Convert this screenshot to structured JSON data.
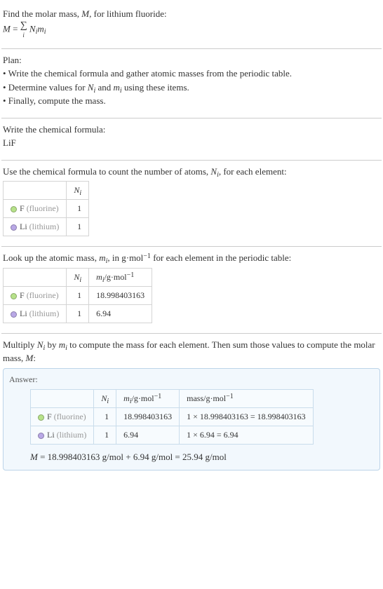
{
  "step1": {
    "intro": "Find the molar mass, ",
    "var_M": "M",
    "intro2": ", for lithium fluoride:",
    "formula_prefix": "M",
    "formula_eq": " = ",
    "sigma": "∑",
    "sigma_sub": "i",
    "Ni": "N",
    "Ni_sub": "i",
    "mi": "m",
    "mi_sub": "i"
  },
  "plan": {
    "head": "Plan:",
    "l1_a": "• Write the chemical formula and gather atomic masses from the periodic table.",
    "l2_pre": "• Determine values for ",
    "l2_mid": " and ",
    "l2_post": " using these items.",
    "l3": "• Finally, compute the mass."
  },
  "chem": {
    "head": "Write the chemical formula:",
    "formula": "LiF"
  },
  "count": {
    "head_a": "Use the chemical formula to count the number of atoms, ",
    "head_b": ", for each element:",
    "col_n": "N",
    "col_n_sub": "i",
    "rows": [
      {
        "color": "#b7e28a",
        "name": "F",
        "paren": " (fluorine)",
        "n": "1"
      },
      {
        "color": "#b9a8e6",
        "name": "Li",
        "paren": " (lithium)",
        "n": "1"
      }
    ]
  },
  "lookup": {
    "head_a": "Look up the atomic mass, ",
    "head_b": ", in g·mol",
    "head_sup": "−1",
    "head_c": " for each element in the periodic table:",
    "col_m_pre": "m",
    "col_m_sub": "i",
    "col_m_unit": "/g·mol",
    "rows": [
      {
        "color": "#b7e28a",
        "name": "F",
        "paren": " (fluorine)",
        "n": "1",
        "m": "18.998403163"
      },
      {
        "color": "#b9a8e6",
        "name": "Li",
        "paren": " (lithium)",
        "n": "1",
        "m": "6.94"
      }
    ]
  },
  "mult": {
    "head_a": "Multiply ",
    "head_b": " by ",
    "head_c": " to compute the mass for each element. Then sum those values to compute the molar mass, ",
    "head_d": ":"
  },
  "answer": {
    "label": "Answer:",
    "col_mass": "mass/g·mol",
    "rows": [
      {
        "color": "#b7e28a",
        "name": "F",
        "paren": " (fluorine)",
        "n": "1",
        "m": "18.998403163",
        "mass": "1 × 18.998403163 = 18.998403163"
      },
      {
        "color": "#b9a8e6",
        "name": "Li",
        "paren": " (lithium)",
        "n": "1",
        "m": "6.94",
        "mass": "1 × 6.94 = 6.94"
      }
    ],
    "final_a": "M",
    "final_b": " = 18.998403163 g/mol + 6.94 g/mol = 25.94 g/mol"
  }
}
